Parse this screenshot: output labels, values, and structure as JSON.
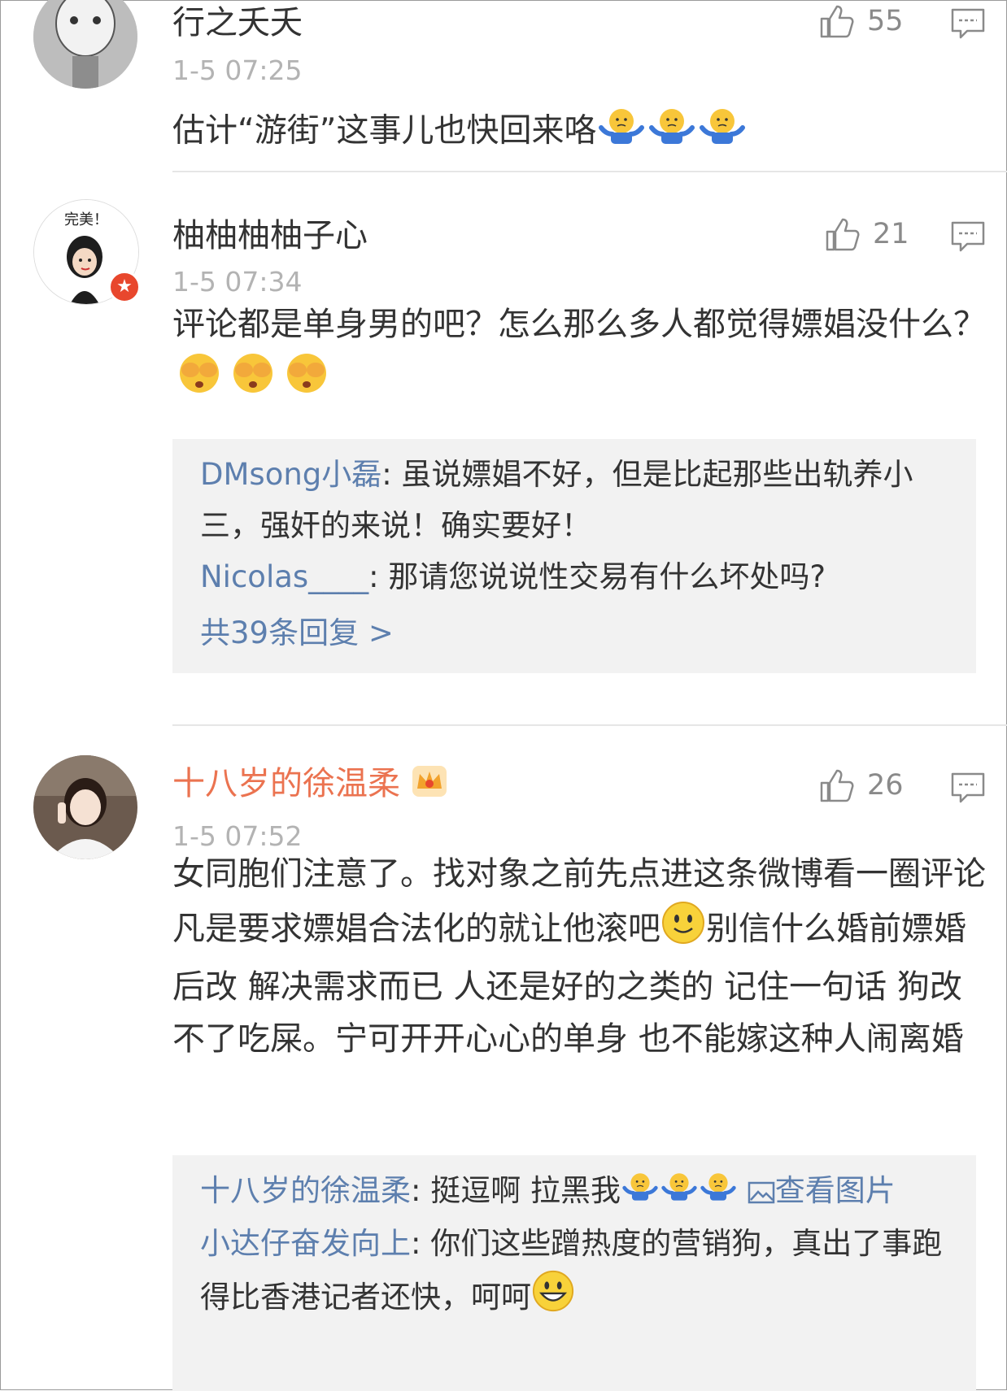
{
  "comments": [
    {
      "name": "行之夭夭",
      "time": "1-5 07:25",
      "likes": "55",
      "text": "估计“游街”这事儿也快回来咯"
    },
    {
      "name": "柚柚柚柚子心",
      "time": "1-5 07:34",
      "likes": "21",
      "avatar_caption": "完美！",
      "text": "评论都是单身男的吧？怎么那么多人都觉得嫖娼没什么？",
      "replies": [
        {
          "name": "DMsong小磊",
          "text": ": 虽说嫖娼不好，但是比起那些出轨养小三，强奸的来说！确实要好！"
        },
        {
          "name": "Nicolas____",
          "text": ": 那请您说说性交易有什么坏处吗?"
        }
      ],
      "more_replies": "共39条回复 >"
    },
    {
      "name": "十八岁的徐温柔",
      "time": "1-5 07:52",
      "likes": "26",
      "text_a": "女同胞们注意了。找对象之前先点进这条微博看一圈评论 凡是要求嫖娼合法化的就让他滚吧",
      "text_b": "别信什么婚前嫖婚后改 解决需求而已 人还是好的之类的 记住一句话 狗改不了吃屎。宁可开开心心的单身 也不能嫁这种人闹离婚",
      "replies": [
        {
          "name": "十八岁的徐温柔",
          "text": ": 挺逗啊 拉黑我",
          "link": "查看图片"
        },
        {
          "name": "小达仔奋发向上",
          "text": ": 你们这些蹭热度的营销狗，真出了事跑得比香港记者还快，呵呵"
        }
      ]
    }
  ],
  "colors": {
    "link_blue": "#5d7fae",
    "vip_orange": "#eb7350",
    "meta_gray": "#b3b3b3"
  },
  "icons": [
    "thumbs-up-icon",
    "comment-reply-icon",
    "shrug-emoji",
    "facepalm-emoji",
    "smile-emoji",
    "grin-emoji",
    "crown-badge-icon",
    "image-icon",
    "verified-badge-icon"
  ]
}
